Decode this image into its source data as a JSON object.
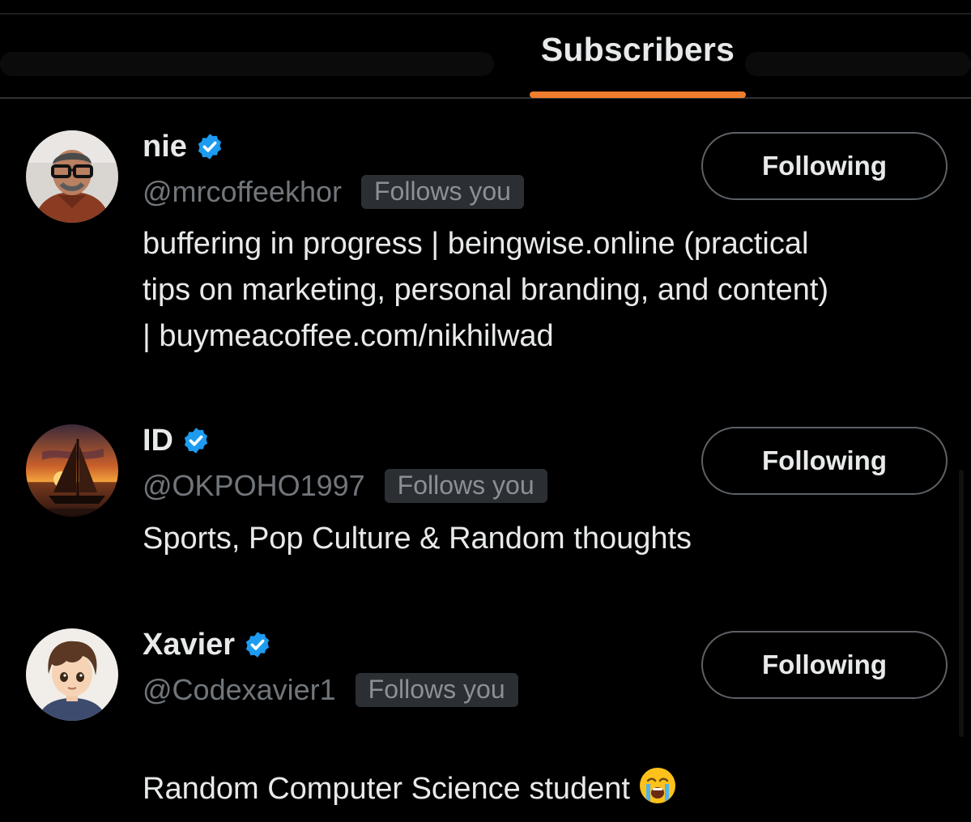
{
  "tabs": {
    "active_label": "Subscribers"
  },
  "colors": {
    "accent_underline": "#ef7d2e",
    "verified_blue": "#1d9bf0",
    "handle_gray": "#71767b",
    "badge_bg": "#2b2f33"
  },
  "users": [
    {
      "display_name": "nie",
      "handle": "@mrcoffeekhor",
      "follows_you": "Follows you",
      "button_label": "Following",
      "bio": "buffering in progress | beingwise.online (practical\ntips on marketing, personal branding, and content)\n| buymeacoffee.com/nikhilwad",
      "verified": true,
      "avatar_icon": "man-with-glasses-avatar"
    },
    {
      "display_name": "ID",
      "handle": "@OKPOHO1997",
      "follows_you": "Follows you",
      "button_label": "Following",
      "bio": "Sports, Pop Culture & Random thoughts",
      "verified": true,
      "avatar_icon": "sailboat-sunset-avatar"
    },
    {
      "display_name": "Xavier",
      "handle": "@Codexavier1",
      "follows_you": "Follows you",
      "button_label": "Following",
      "bio": "Random Computer Science student",
      "bio_emoji": "😭",
      "verified": true,
      "avatar_icon": "anime-boy-avatar"
    }
  ]
}
